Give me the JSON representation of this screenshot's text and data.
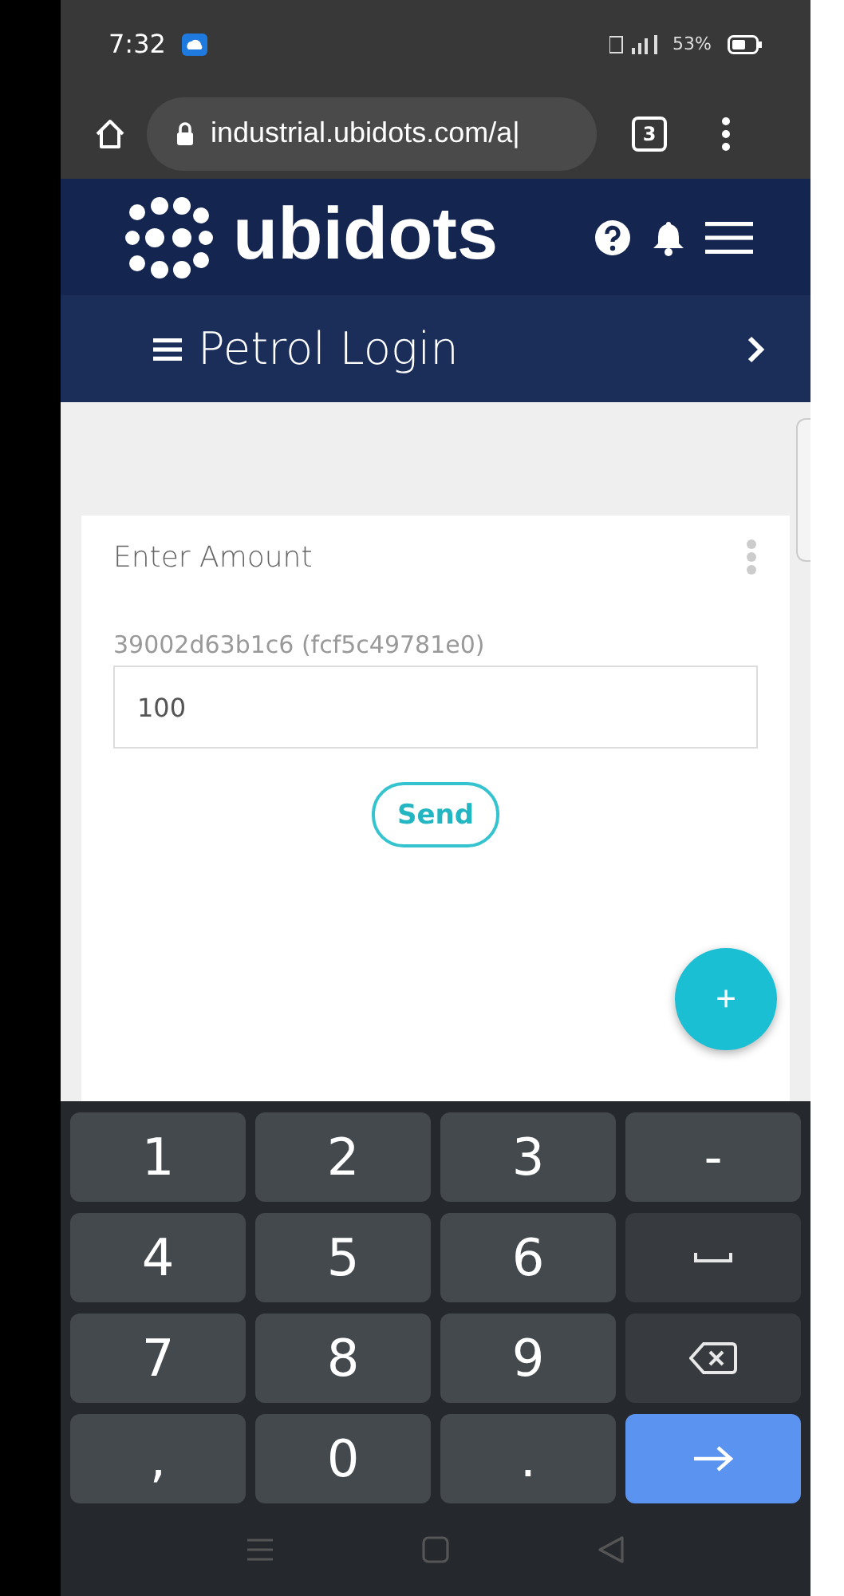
{
  "status_bar": {
    "time": "7:32",
    "battery": "53%"
  },
  "browser": {
    "url": "industrial.ubidots.com/a|",
    "tab_count": "3"
  },
  "header": {
    "logo": "ubidots"
  },
  "dashboard_bar": {
    "title": "Petrol Login"
  },
  "widget": {
    "title": "Enter Amount",
    "variable_label": "39002d63b1c6 (fcf5c49781e0)",
    "value": "100",
    "button": "Send",
    "fab": "+"
  },
  "keyboard": {
    "keys": [
      {
        "kind": "char",
        "label": "1"
      },
      {
        "kind": "char",
        "label": "2"
      },
      {
        "kind": "char",
        "label": "3"
      },
      {
        "kind": "char",
        "label": "-"
      },
      {
        "kind": "char",
        "label": "4"
      },
      {
        "kind": "char",
        "label": "5"
      },
      {
        "kind": "char",
        "label": "6"
      },
      {
        "kind": "space"
      },
      {
        "kind": "char",
        "label": "7"
      },
      {
        "kind": "char",
        "label": "8"
      },
      {
        "kind": "char",
        "label": "9"
      },
      {
        "kind": "backspace"
      },
      {
        "kind": "char",
        "label": ","
      },
      {
        "kind": "char",
        "label": "0"
      },
      {
        "kind": "char",
        "label": "."
      },
      {
        "kind": "enter"
      }
    ]
  }
}
